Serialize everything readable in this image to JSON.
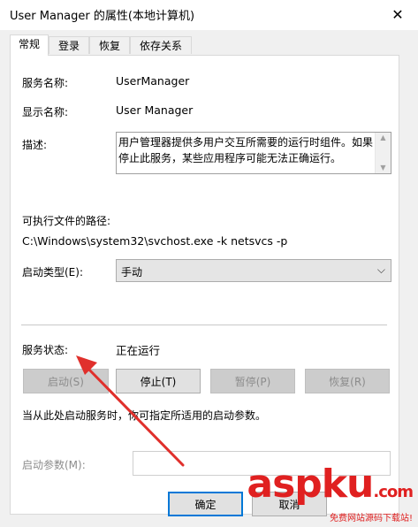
{
  "window": {
    "title": "User Manager 的属性(本地计算机)",
    "close_glyph": "✕"
  },
  "tabs": [
    {
      "label": "常规",
      "active": true
    },
    {
      "label": "登录",
      "active": false
    },
    {
      "label": "恢复",
      "active": false
    },
    {
      "label": "依存关系",
      "active": false
    }
  ],
  "general": {
    "service_name_label": "服务名称:",
    "service_name": "UserManager",
    "display_name_label": "显示名称:",
    "display_name": "User Manager",
    "description_label": "描述:",
    "description": "用户管理器提供多用户交互所需要的运行时组件。如果停止此服务，某些应用程序可能无法正确运行。",
    "exe_path_label": "可执行文件的路径:",
    "exe_path": "C:\\Windows\\system32\\svchost.exe -k netsvcs -p",
    "startup_type_label": "启动类型(E):",
    "startup_type_value": "手动",
    "status_label": "服务状态:",
    "status_value": "正在运行",
    "buttons": {
      "start": "启动(S)",
      "stop": "停止(T)",
      "pause": "暂停(P)",
      "resume": "恢复(R)"
    },
    "hint": "当从此处启动服务时，你可指定所适用的启动参数。",
    "start_params_label": "启动参数(M):",
    "start_params_value": ""
  },
  "footer": {
    "ok": "确定",
    "cancel": "取消"
  },
  "watermark": {
    "main": "aspku",
    "dot": ".com",
    "sub": "免费网站源码下载站!"
  },
  "colors": {
    "accent": "#0078d7",
    "annotation_arrow": "#e0302c",
    "watermark": "#e02020"
  }
}
